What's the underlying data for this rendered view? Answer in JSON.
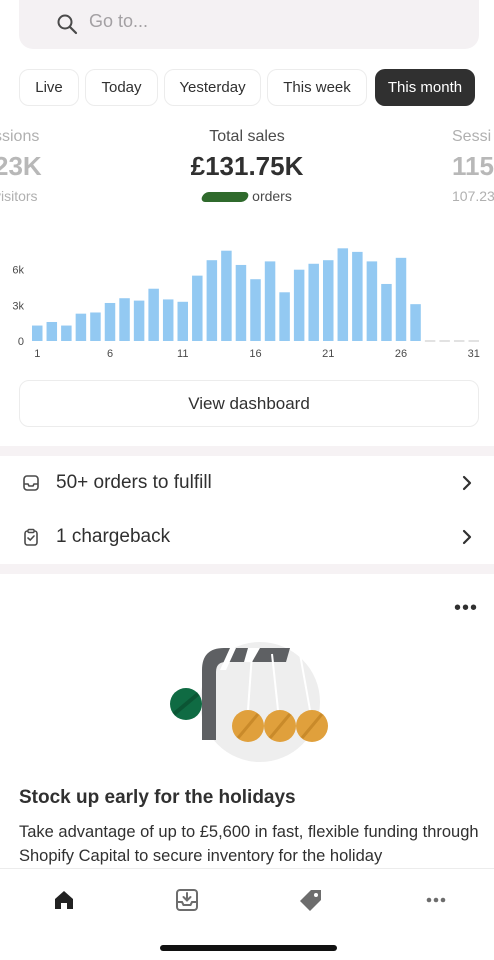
{
  "search": {
    "placeholder": "Go to...",
    "icon": "search-icon"
  },
  "tabs": [
    {
      "label": "Live",
      "active": false
    },
    {
      "label": "Today",
      "active": false
    },
    {
      "label": "Yesterday",
      "active": false
    },
    {
      "label": "This week",
      "active": false
    },
    {
      "label": "This month",
      "active": true
    }
  ],
  "stats": {
    "left": {
      "label": "ssions",
      "value": "23K",
      "sub": "visitors"
    },
    "center": {
      "label": "Total sales",
      "value": "£131.75K",
      "sub": "orders"
    },
    "right": {
      "label": "Sessi",
      "value": "115",
      "sub": "107.23"
    }
  },
  "chart_data": {
    "type": "bar",
    "categories": [
      "1",
      "2",
      "3",
      "4",
      "5",
      "6",
      "7",
      "8",
      "9",
      "10",
      "11",
      "12",
      "13",
      "14",
      "15",
      "16",
      "17",
      "18",
      "19",
      "20",
      "21",
      "22",
      "23",
      "24",
      "25",
      "26",
      "27",
      "28",
      "29",
      "30",
      "31"
    ],
    "values": [
      1300,
      1600,
      1300,
      2300,
      2400,
      3200,
      3600,
      3400,
      4400,
      3500,
      3300,
      5500,
      6800,
      7600,
      6400,
      5200,
      6700,
      4100,
      6000,
      6500,
      6800,
      7800,
      7500,
      6700,
      4800,
      7000,
      3100,
      0,
      0,
      0,
      0
    ],
    "x_tick_labels": [
      "1",
      "6",
      "11",
      "16",
      "21",
      "26",
      "31"
    ],
    "y_tick_labels": [
      "0",
      "3k",
      "6k"
    ],
    "ylim": [
      0,
      8500
    ],
    "bar_color": "#93c9f2",
    "grid": false
  },
  "actions": {
    "view_dashboard": "View dashboard",
    "orders_to_fulfill": "50+ orders to fulfill",
    "chargeback": "1 chargeback"
  },
  "card": {
    "more_label": "•••",
    "title": "Stock up early for the holidays",
    "body": "Take advantage of up to £5,600 in fast, flexible funding through Shopify Capital to secure inventory for the holiday"
  },
  "nav": [
    {
      "name": "home",
      "icon": "home-icon"
    },
    {
      "name": "orders",
      "icon": "inbox-download-icon"
    },
    {
      "name": "products",
      "icon": "tag-icon"
    },
    {
      "name": "more",
      "icon": "more-icon"
    }
  ],
  "colors": {
    "accent_dark": "#303030",
    "bar": "#93c9f2",
    "separator": "#f6f2f4",
    "illustration_orange": "#e0a03c",
    "illustration_green": "#0f6b43"
  }
}
